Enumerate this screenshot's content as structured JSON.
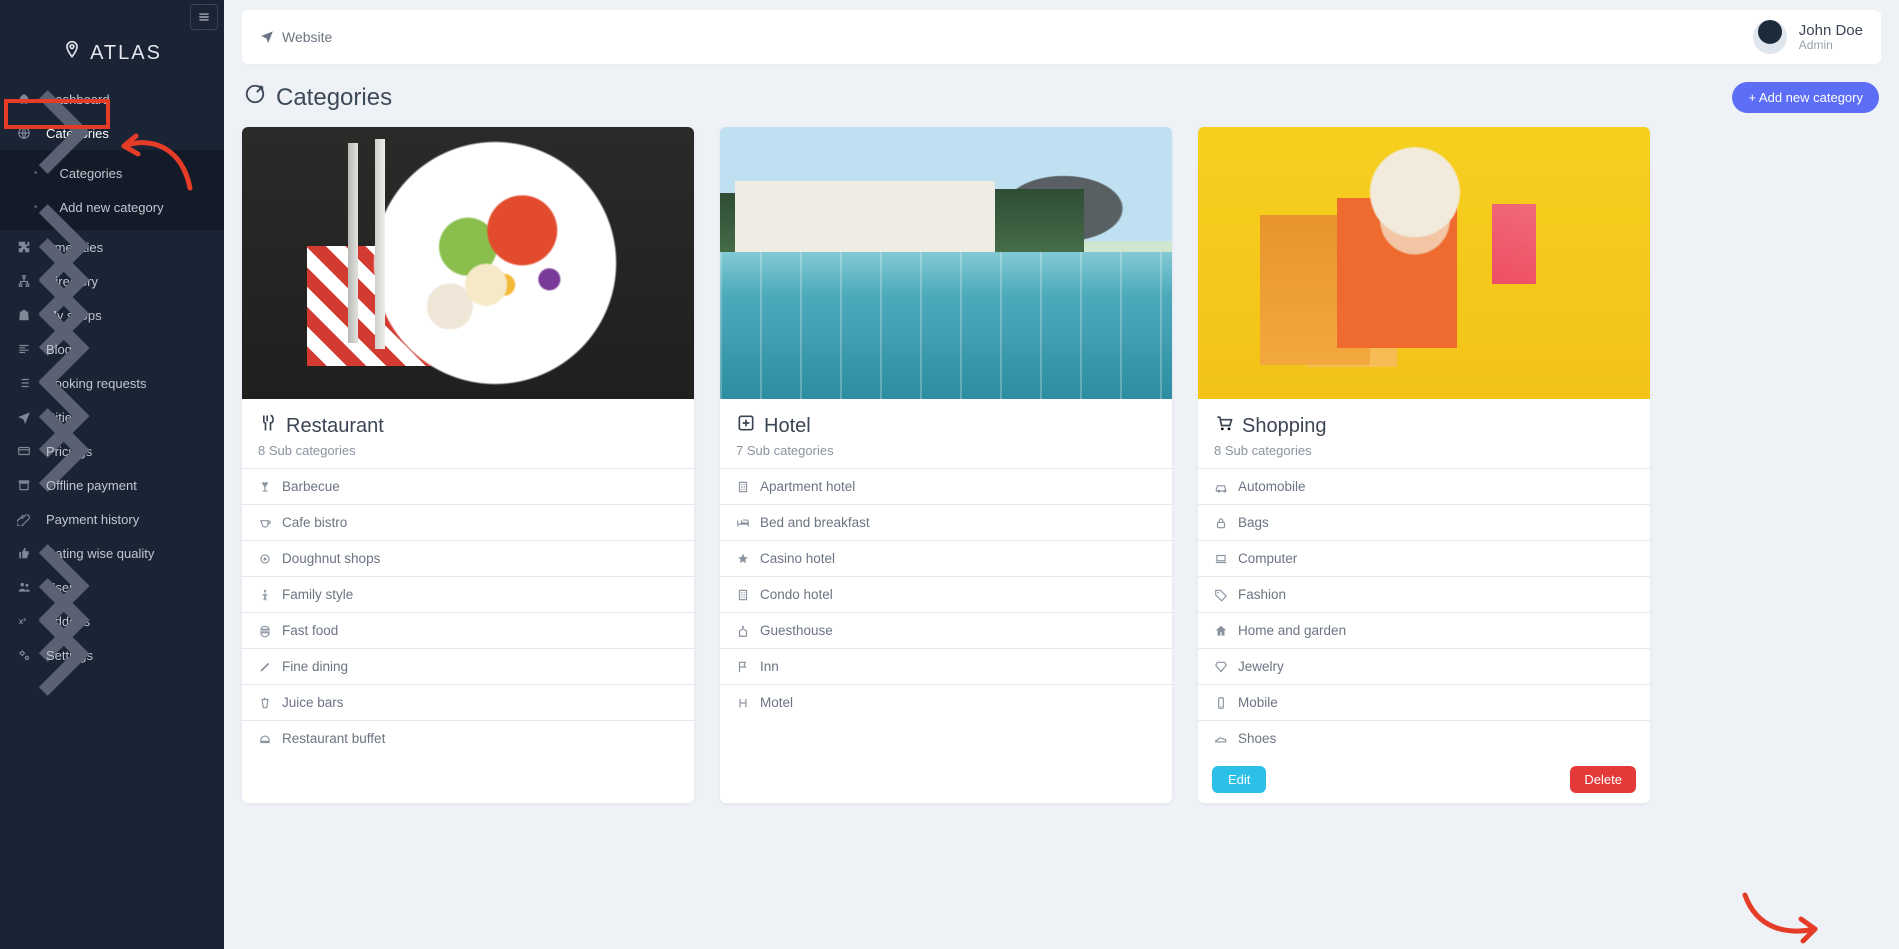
{
  "brand": "ATLAS",
  "topbar": {
    "website_label": "Website"
  },
  "user": {
    "name": "John Doe",
    "role": "Admin"
  },
  "page": {
    "title": "Categories",
    "add_btn": "+ Add new category",
    "edit_btn": "Edit",
    "delete_btn": "Delete"
  },
  "sidebar": {
    "items": [
      {
        "label": "Dashboard",
        "icon": "home-icon",
        "expandable": false
      },
      {
        "label": "Categories",
        "icon": "globe-icon",
        "expandable": true,
        "open": true,
        "children": [
          "Categories",
          "Add new category"
        ]
      },
      {
        "label": "Amenities",
        "icon": "puzzle-icon",
        "expandable": true
      },
      {
        "label": "Directory",
        "icon": "sitemap-icon",
        "expandable": true
      },
      {
        "label": "My shops",
        "icon": "bag-icon",
        "expandable": true
      },
      {
        "label": "Blog",
        "icon": "lines-icon",
        "expandable": true
      },
      {
        "label": "Booking requests",
        "icon": "list-icon",
        "expandable": false
      },
      {
        "label": "Cities",
        "icon": "plane-icon",
        "expandable": true
      },
      {
        "label": "Pricings",
        "icon": "card-icon",
        "expandable": true
      },
      {
        "label": "Offline payment",
        "icon": "archive-icon",
        "expandable": false
      },
      {
        "label": "Payment history",
        "icon": "clip-icon",
        "expandable": false
      },
      {
        "label": "Rating wise quality",
        "icon": "thumb-icon",
        "expandable": false
      },
      {
        "label": "Users",
        "icon": "users-icon",
        "expandable": true
      },
      {
        "label": "Addons",
        "icon": "x2-icon",
        "expandable": true
      },
      {
        "label": "Settings",
        "icon": "cogs-icon",
        "expandable": true
      }
    ]
  },
  "categories": [
    {
      "title": "Restaurant",
      "title_icon": "utensils-icon",
      "sub": "8 Sub categories",
      "items": [
        {
          "icon": "glass-icon",
          "label": "Barbecue"
        },
        {
          "icon": "coffee-icon",
          "label": "Cafe bistro"
        },
        {
          "icon": "donut-icon",
          "label": "Doughnut shops"
        },
        {
          "icon": "child-icon",
          "label": "Family style"
        },
        {
          "icon": "burger-icon",
          "label": "Fast food"
        },
        {
          "icon": "pen-icon",
          "label": "Fine dining"
        },
        {
          "icon": "juice-icon",
          "label": "Juice bars"
        },
        {
          "icon": "bell-icon",
          "label": "Restaurant buffet"
        }
      ]
    },
    {
      "title": "Hotel",
      "title_icon": "hospital-icon",
      "sub": "7 Sub categories",
      "items": [
        {
          "icon": "building-icon",
          "label": "Apartment hotel"
        },
        {
          "icon": "bed-icon",
          "label": "Bed and breakfast"
        },
        {
          "icon": "star-icon",
          "label": "Casino hotel"
        },
        {
          "icon": "building-icon",
          "label": "Condo hotel"
        },
        {
          "icon": "church-icon",
          "label": "Guesthouse"
        },
        {
          "icon": "flag-icon",
          "label": "Inn"
        },
        {
          "icon": "h-icon",
          "label": "Motel"
        }
      ]
    },
    {
      "title": "Shopping",
      "title_icon": "cart-icon",
      "sub": "8 Sub categories",
      "items": [
        {
          "icon": "car-icon",
          "label": "Automobile"
        },
        {
          "icon": "lock-icon",
          "label": "Bags"
        },
        {
          "icon": "laptop-icon",
          "label": "Computer"
        },
        {
          "icon": "tag-icon",
          "label": "Fashion"
        },
        {
          "icon": "home-icon",
          "label": "Home and garden"
        },
        {
          "icon": "gem-icon",
          "label": "Jewelry"
        },
        {
          "icon": "mobile-icon",
          "label": "Mobile"
        },
        {
          "icon": "shoe-icon",
          "label": "Shoes"
        }
      ],
      "show_actions": true
    }
  ]
}
